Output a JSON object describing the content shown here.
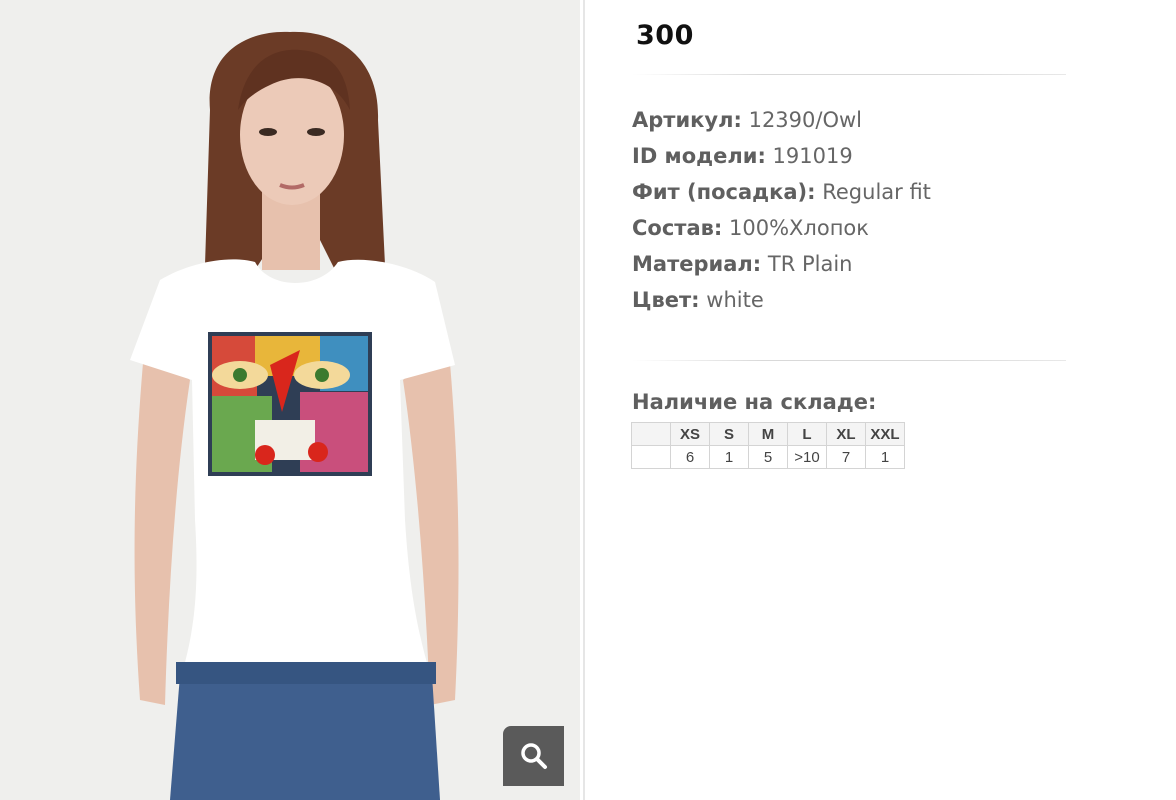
{
  "product": {
    "price": "300",
    "specs": [
      {
        "label": "Артикул:",
        "value": " 12390/Owl"
      },
      {
        "label": "ID модели:",
        "value": " 191019"
      },
      {
        "label": "Фит (посадка):",
        "value": " Regular fit"
      },
      {
        "label": "Состав:",
        "value": " 100%Хлопок"
      },
      {
        "label": "Материал:",
        "value": " TR Plain"
      },
      {
        "label": "Цвет:",
        "value": " white"
      }
    ]
  },
  "stock": {
    "title": "Наличие на складе:",
    "sizes": [
      "XS",
      "S",
      "M",
      "L",
      "XL",
      "XXL"
    ],
    "quantities": [
      "6",
      "1",
      "5",
      ">10",
      "7",
      "1"
    ]
  },
  "icons": {
    "zoom": "magnifier-icon"
  },
  "colors": {
    "zoom_button": "#5a5a5a",
    "price_text": "#111111",
    "spec_text": "#666666"
  }
}
